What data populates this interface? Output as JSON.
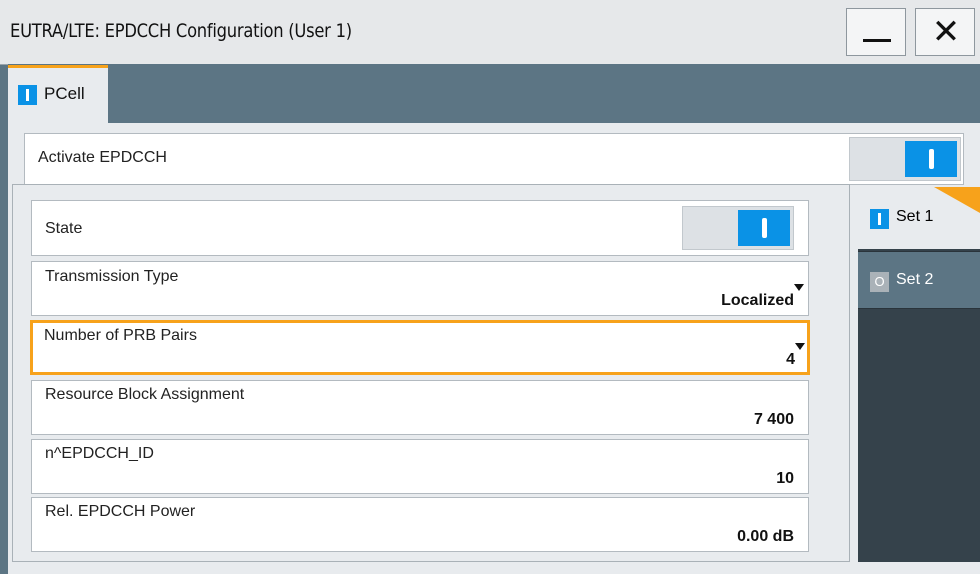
{
  "window": {
    "title": "EUTRA/LTE: EPDCCH Configuration (User 1)",
    "close_glyph": "✕"
  },
  "tabs": [
    {
      "label": "PCell",
      "active": true
    }
  ],
  "activate": {
    "label": "Activate EPDCCH",
    "on": true
  },
  "sets": [
    {
      "label": "Set 1",
      "on": true,
      "indicator": ""
    },
    {
      "label": "Set 2",
      "on": false,
      "indicator": "O"
    }
  ],
  "fields": {
    "state": {
      "label": "State",
      "on": true
    },
    "transmission_type": {
      "label": "Transmission Type",
      "value": "Localized"
    },
    "prb_pairs": {
      "label": "Number of PRB Pairs",
      "value": "4"
    },
    "rb_assignment": {
      "label": "Resource Block Assignment",
      "value": "7 400"
    },
    "n_epdcch_id": {
      "label": "n^EPDCCH_ID",
      "value": "10"
    },
    "rel_power": {
      "label": "Rel. EPDCCH Power",
      "value": "0.00 dB"
    }
  },
  "colors": {
    "accent": "#f7a21b",
    "toggle_on": "#0a92e6",
    "frame": "#5c7584",
    "panel": "#e8ebee",
    "set_panel": "#35424b"
  },
  "icons": {
    "minimize": "minimize-icon",
    "close": "close-icon",
    "on_indicator": "on-indicator-icon",
    "off_indicator": "off-indicator-icon",
    "dropdown": "dropdown-arrow-icon"
  }
}
